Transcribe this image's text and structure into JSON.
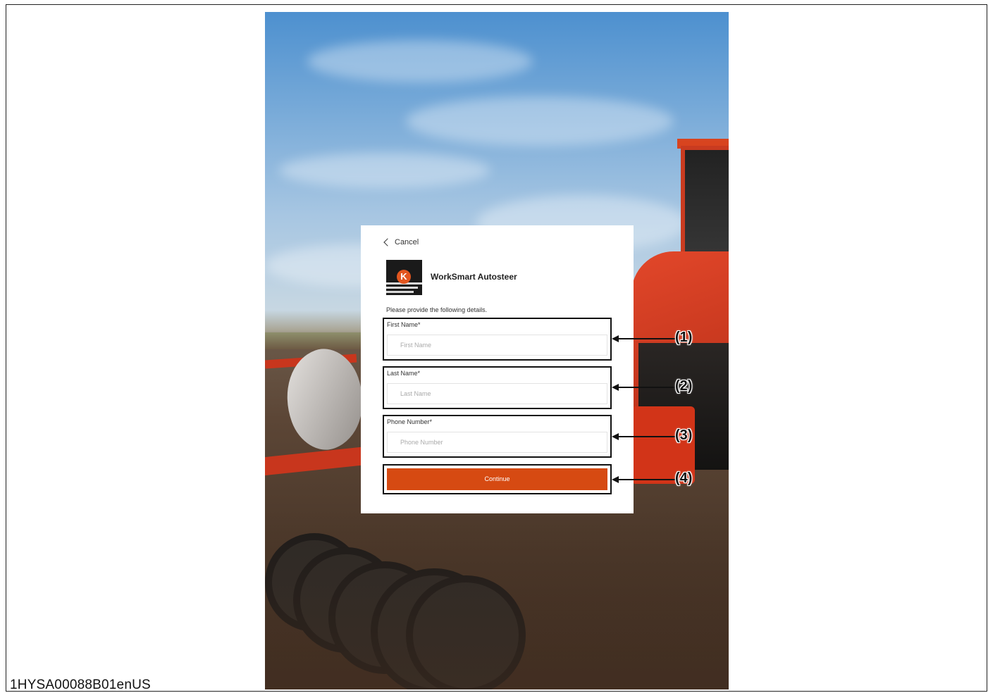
{
  "document": {
    "id": "1HYSA00088B01enUS"
  },
  "dialog": {
    "cancel_label": "Cancel",
    "app_title": "WorkSmart Autosteer",
    "logo_letter": "K",
    "instructions": "Please provide the following details.",
    "fields": [
      {
        "label": "First Name*",
        "placeholder": "First Name"
      },
      {
        "label": "Last Name*",
        "placeholder": "Last Name"
      },
      {
        "label": "Phone Number*",
        "placeholder": "Phone Number"
      }
    ],
    "continue_label": "Continue"
  },
  "callouts": [
    "(1)",
    "(2)",
    "(3)",
    "(4)"
  ],
  "colors": {
    "accent": "#d64a12",
    "callout_line": "#111111"
  }
}
